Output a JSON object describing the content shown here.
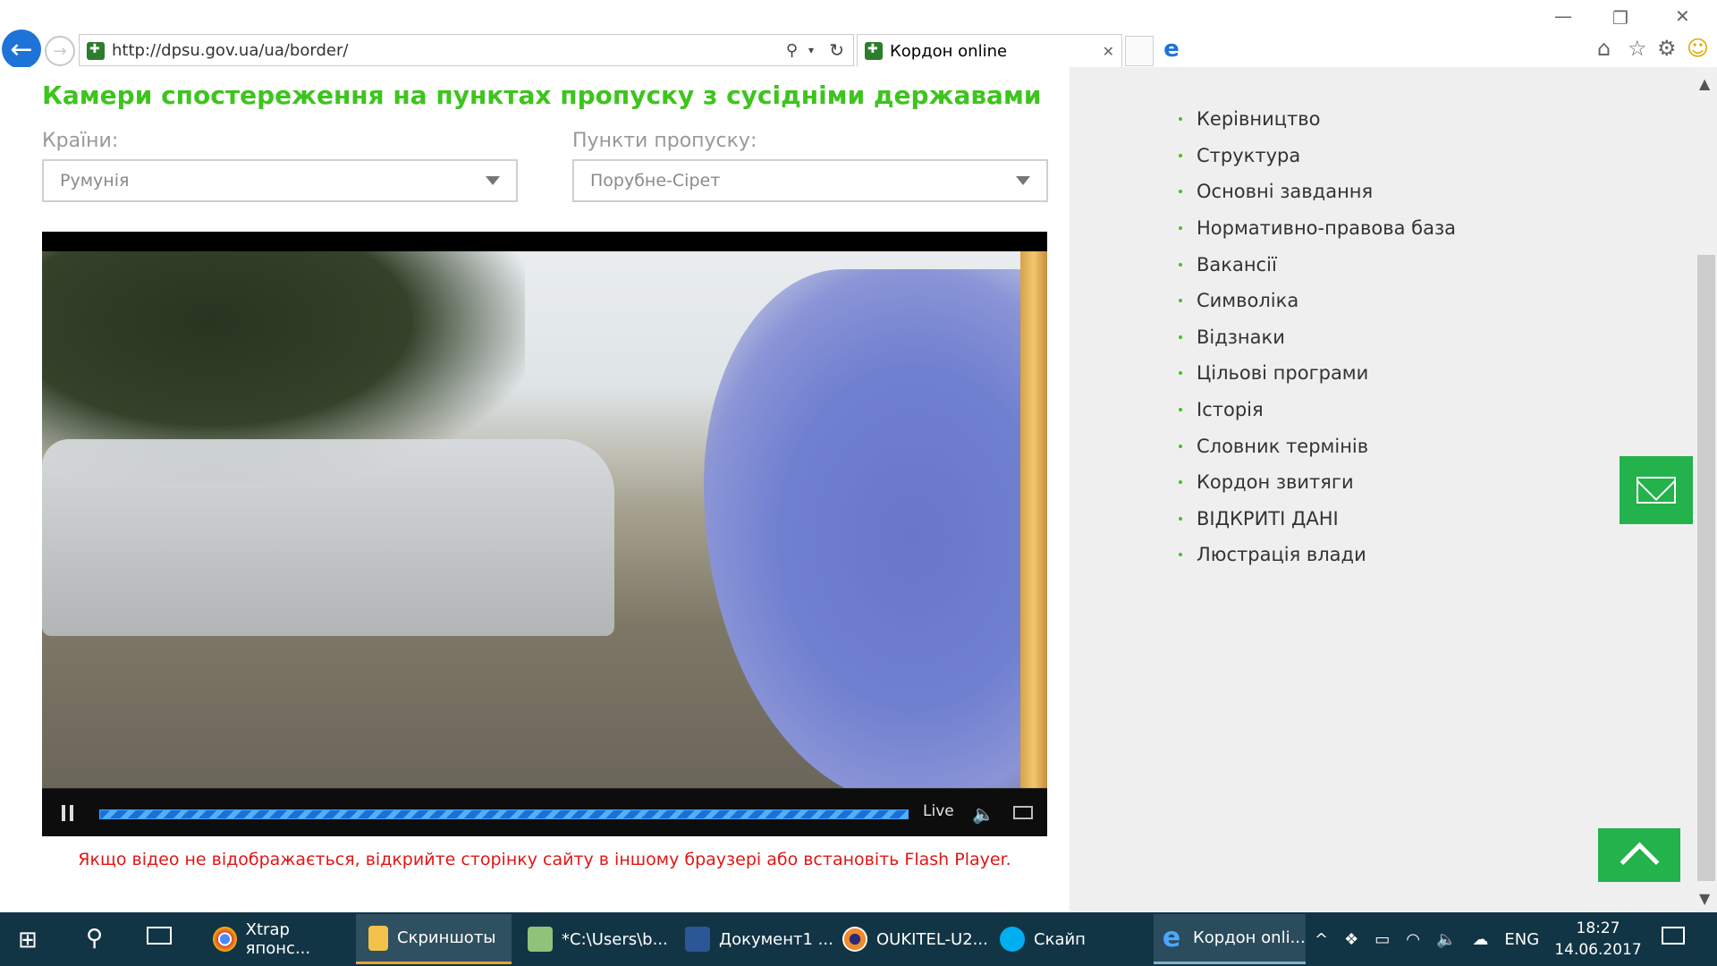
{
  "browser": {
    "url": "http://dpsu.gov.ua/ua/border/",
    "tab_title": "Кордон online"
  },
  "page": {
    "heading": "Камери спостереження на пунктах пропуску з сусідніми державами",
    "countries_label": "Країни:",
    "countries_value": "Румунія",
    "checkpoints_label": "Пункти пропуску:",
    "checkpoints_value": "Порубне-Сірет",
    "player_live_label": "Live",
    "notice": "Якщо відео не відображається, відкрийте сторінку сайту в іншому браузері або встановіть Flash Player."
  },
  "sidebar": {
    "items": [
      {
        "label": "Керівництво"
      },
      {
        "label": "Структура"
      },
      {
        "label": "Основні завдання"
      },
      {
        "label": "Нормативно-правова база"
      },
      {
        "label": "Вакансії"
      },
      {
        "label": "Символіка"
      },
      {
        "label": "Відзнаки"
      },
      {
        "label": "Цільові програми"
      },
      {
        "label": "Історія"
      },
      {
        "label": "Словник термінів"
      },
      {
        "label": "Кордон звитяги"
      },
      {
        "label": "ВІДКРИТІ ДАНІ"
      },
      {
        "label": "Люстрація влади"
      }
    ]
  },
  "taskbar": {
    "items": [
      {
        "label": "Xtrap японс...",
        "icon": "chrome-icon"
      },
      {
        "label": "Скриншоты",
        "icon": "folder-icon"
      },
      {
        "label": "*C:\\Users\\b...",
        "icon": "notepad-icon"
      },
      {
        "label": "Документ1 ...",
        "icon": "word-icon"
      },
      {
        "label": "OUKITEL-U2...",
        "icon": "app-icon"
      },
      {
        "label": "Скайп",
        "icon": "skype-icon"
      },
      {
        "label": "Кордон onli...",
        "icon": "ie-icon"
      }
    ],
    "language": "ENG",
    "time": "18:27",
    "date": "14.06.2017"
  },
  "colors": {
    "accent_green": "#3ec41e",
    "button_green": "#23b24b",
    "notice_red": "#e01616",
    "taskbar": "#123545"
  }
}
